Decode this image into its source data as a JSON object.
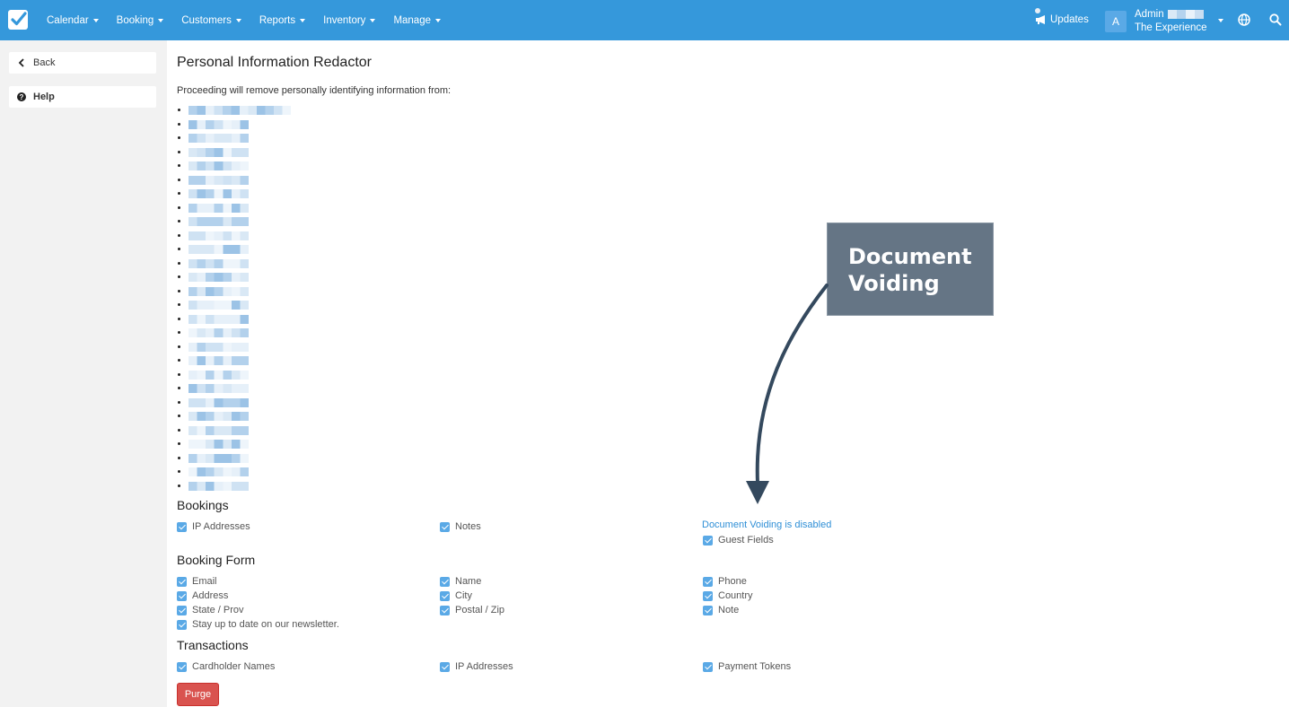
{
  "nav": {
    "items": [
      "Calendar",
      "Booking",
      "Customers",
      "Reports",
      "Inventory",
      "Manage"
    ],
    "updates_label": "Updates",
    "avatar_letter": "A",
    "user_name": "Admin",
    "user_org": "The Experience"
  },
  "sidebar": {
    "back_label": "Back",
    "help_label": "Help"
  },
  "page": {
    "title": "Personal Information Redactor",
    "intro": "Proceeding will remove personally identifying information from:"
  },
  "bookings": {
    "title": "Bookings",
    "ip_addresses": "IP Addresses",
    "notes": "Notes",
    "voiding_link": "Document Voiding is disabled",
    "guest_fields": "Guest Fields"
  },
  "booking_form": {
    "title": "Booking Form",
    "email": "Email",
    "name": "Name",
    "phone": "Phone",
    "address": "Address",
    "city": "City",
    "country": "Country",
    "state": "State / Prov",
    "postal": "Postal / Zip",
    "note": "Note",
    "newsletter": "Stay up to date on our newsletter."
  },
  "transactions": {
    "title": "Transactions",
    "cardholder": "Cardholder Names",
    "ip_addresses": "IP Addresses",
    "payment_tokens": "Payment Tokens"
  },
  "purge_label": "Purge",
  "annotation": {
    "line1": "Document",
    "line2": "Voiding"
  },
  "colors": {
    "topbar": "#3598db",
    "purge": "#d9534f",
    "link": "#2f8fd6",
    "callout": "#657585"
  }
}
